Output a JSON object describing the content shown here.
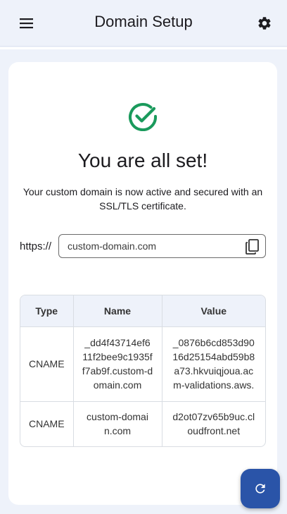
{
  "header": {
    "title": "Domain Setup",
    "menu_icon": "hamburger-menu-icon",
    "settings_icon": "gear-icon"
  },
  "status": {
    "icon": "check-circle-icon",
    "headline": "You are all set!",
    "message": "Your custom domain is now active and secured with an SSL/TLS certificate."
  },
  "domain": {
    "prefix": "https://",
    "value": "custom-domain.com",
    "copy_icon": "copy-icon"
  },
  "dns_table": {
    "columns": [
      "Type",
      "Name",
      "Value"
    ],
    "rows": [
      {
        "type": "CNAME",
        "name": "_dd4f43714ef611f2bee9c1935ff7ab9f.custom-domain.com",
        "value": "_0876b6cd853d9016d25154abd59b8a73.hkvuiqjoua.acm-validations.aws."
      },
      {
        "type": "CNAME",
        "name": "custom-domain.com",
        "value": "d2ot07zv65b9uc.cloudfront.net"
      }
    ]
  },
  "fab": {
    "icon": "refresh-icon"
  },
  "colors": {
    "accent": "#2a54a8",
    "success": "#1a9a5c",
    "background": "#eef2fa"
  }
}
